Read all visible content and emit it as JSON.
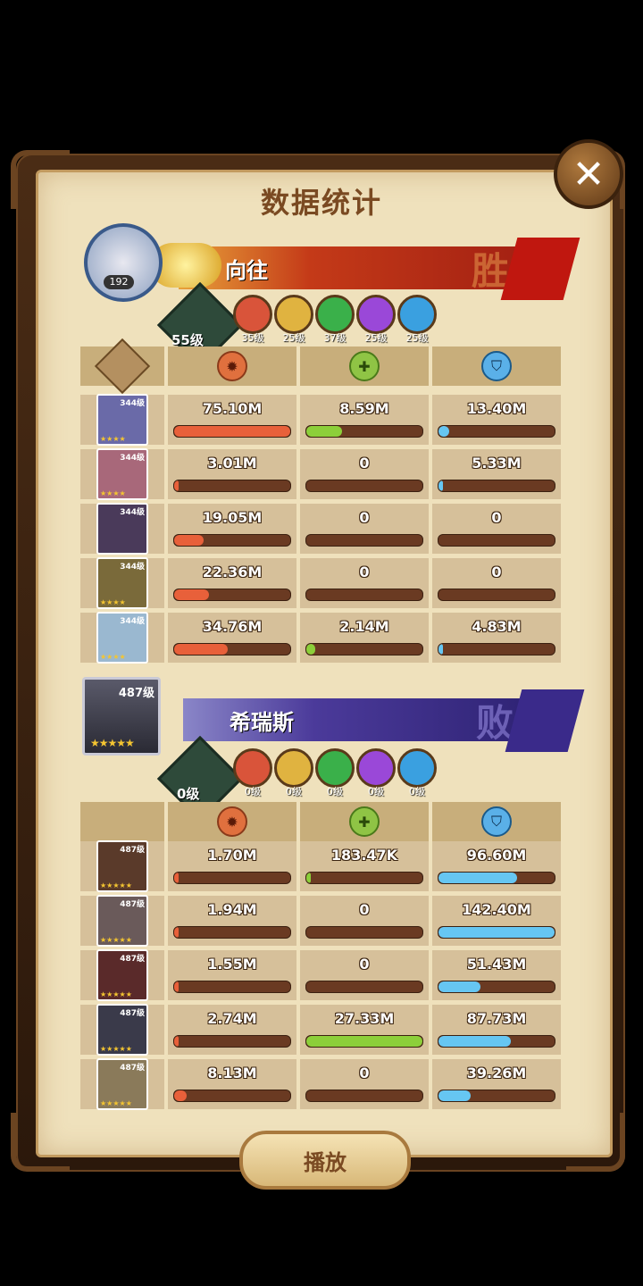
{
  "title": "数据统计",
  "close_label": "✕",
  "team1": {
    "avatar_level": "192",
    "name": "向往",
    "result": "胜",
    "gear_level": "55级",
    "factions": [
      {
        "level": "35级",
        "color": "#d9543a"
      },
      {
        "level": "25级",
        "color": "#e0b340"
      },
      {
        "level": "37级",
        "color": "#3ab04a"
      },
      {
        "level": "25级",
        "color": "#9a48d8"
      },
      {
        "level": "25级",
        "color": "#3aa0e0"
      }
    ],
    "heroes": [
      {
        "level": "344级",
        "stars": "★★★★",
        "bg": "#6a6aa8",
        "damage": "75.10M",
        "damage_pct": 1.0,
        "heal": "8.59M",
        "heal_pct": 0.31,
        "shield": "13.40M",
        "shield_pct": 0.09
      },
      {
        "level": "344级",
        "stars": "★★★★",
        "bg": "#a8687a",
        "damage": "3.01M",
        "damage_pct": 0.04,
        "heal": "0",
        "heal_pct": 0,
        "shield": "5.33M",
        "shield_pct": 0.04
      },
      {
        "level": "344级",
        "stars": "",
        "bg": "#4a3a5a",
        "damage": "19.05M",
        "damage_pct": 0.25,
        "heal": "0",
        "heal_pct": 0,
        "shield": "0",
        "shield_pct": 0
      },
      {
        "level": "344级",
        "stars": "★★★★",
        "bg": "#7a6a3a",
        "damage": "22.36M",
        "damage_pct": 0.3,
        "heal": "0",
        "heal_pct": 0,
        "shield": "0",
        "shield_pct": 0
      },
      {
        "level": "344级",
        "stars": "★★★★",
        "bg": "#9ab8d0",
        "damage": "34.76M",
        "damage_pct": 0.46,
        "heal": "2.14M",
        "heal_pct": 0.08,
        "shield": "4.83M",
        "shield_pct": 0.03
      }
    ]
  },
  "team2": {
    "card_level": "487级",
    "card_stars": "★★★★★",
    "name": "希瑞斯",
    "result": "败",
    "gear_level": "0级",
    "factions": [
      {
        "level": "0级",
        "color": "#d9543a"
      },
      {
        "level": "0级",
        "color": "#e0b340"
      },
      {
        "level": "0级",
        "color": "#3ab04a"
      },
      {
        "level": "0级",
        "color": "#9a48d8"
      },
      {
        "level": "0级",
        "color": "#3aa0e0"
      }
    ],
    "heroes": [
      {
        "level": "487级",
        "stars": "★★★★★",
        "bg": "#5a3a2a",
        "damage": "1.70M",
        "damage_pct": 0.03,
        "heal": "183.47K",
        "heal_pct": 0.01,
        "shield": "96.60M",
        "shield_pct": 0.68
      },
      {
        "level": "487级",
        "stars": "★★★★★",
        "bg": "#6a5a5a",
        "damage": "1.94M",
        "damage_pct": 0.03,
        "heal": "0",
        "heal_pct": 0,
        "shield": "142.40M",
        "shield_pct": 1.0
      },
      {
        "level": "487级",
        "stars": "★★★★★",
        "bg": "#5a2a2a",
        "damage": "1.55M",
        "damage_pct": 0.03,
        "heal": "0",
        "heal_pct": 0,
        "shield": "51.43M",
        "shield_pct": 0.36
      },
      {
        "level": "487级",
        "stars": "★★★★★",
        "bg": "#3a3a4a",
        "damage": "2.74M",
        "damage_pct": 0.04,
        "heal": "27.33M",
        "heal_pct": 1.0,
        "shield": "87.73M",
        "shield_pct": 0.62
      },
      {
        "level": "487级",
        "stars": "★★★★★",
        "bg": "#8a7a5a",
        "damage": "8.13M",
        "damage_pct": 0.11,
        "heal": "0",
        "heal_pct": 0,
        "shield": "39.26M",
        "shield_pct": 0.28
      }
    ]
  },
  "play_button": "播放"
}
